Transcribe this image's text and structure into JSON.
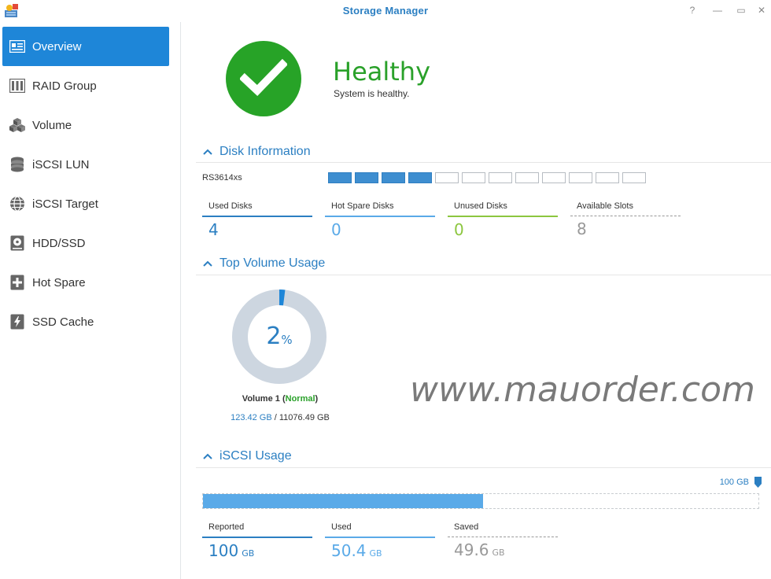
{
  "window": {
    "title": "Storage Manager",
    "help": "?",
    "minimize": "—",
    "maximize": "▭",
    "close": "✕"
  },
  "sidebar": {
    "items": [
      {
        "label": "Overview",
        "icon": "overview-icon",
        "active": true
      },
      {
        "label": "RAID Group",
        "icon": "raid-group-icon"
      },
      {
        "label": "Volume",
        "icon": "volume-icon"
      },
      {
        "label": "iSCSI LUN",
        "icon": "iscsi-lun-icon"
      },
      {
        "label": "iSCSI Target",
        "icon": "iscsi-target-icon"
      },
      {
        "label": "HDD/SSD",
        "icon": "hdd-ssd-icon"
      },
      {
        "label": "Hot Spare",
        "icon": "hot-spare-icon"
      },
      {
        "label": "SSD Cache",
        "icon": "ssd-cache-icon"
      }
    ]
  },
  "health": {
    "status": "Healthy",
    "message": "System is healthy.",
    "color": "#27a327"
  },
  "disk_info": {
    "heading": "Disk Information",
    "model": "RS3614xs",
    "total_slots": 12,
    "used_slots": 4,
    "stats": [
      {
        "label": "Used Disks",
        "value": "4",
        "color": "#2b7fc2"
      },
      {
        "label": "Hot Spare Disks",
        "value": "0",
        "color": "#5aaae8"
      },
      {
        "label": "Unused Disks",
        "value": "0",
        "color": "#8cc63f"
      },
      {
        "label": "Available Slots",
        "value": "8",
        "color": "#999999"
      }
    ]
  },
  "volume_usage": {
    "heading": "Top Volume Usage",
    "percent": 2,
    "percent_value": "2",
    "percent_sign": "%",
    "name": "Volume 1",
    "status": "Normal",
    "used": "123.42 GB",
    "separator": " / ",
    "total": "11076.49 GB"
  },
  "watermark": "www.mauorder.com",
  "iscsi_usage": {
    "heading": "iSCSI Usage",
    "capacity_label": "100 GB",
    "used_fraction": 0.504,
    "stats": [
      {
        "label": "Reported",
        "value": "100",
        "unit": "GB",
        "color": "#2b7fc2"
      },
      {
        "label": "Used",
        "value": "50.4",
        "unit": "GB",
        "color": "#5aaae8"
      },
      {
        "label": "Saved",
        "value": "49.6",
        "unit": "GB",
        "color": "#999999"
      }
    ]
  }
}
